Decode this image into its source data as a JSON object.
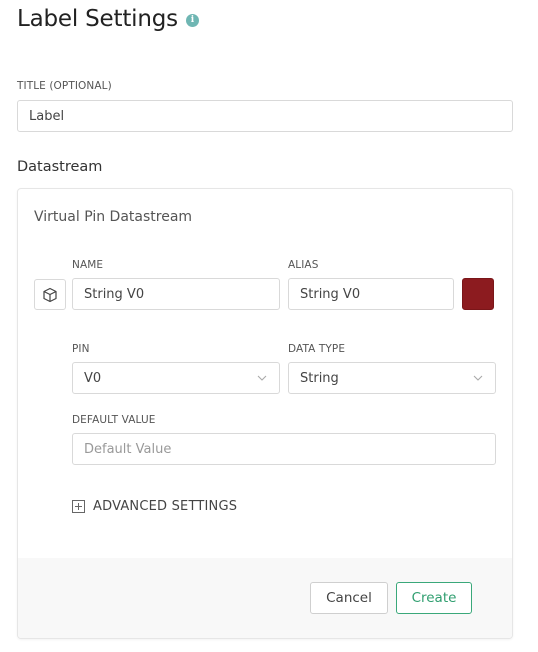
{
  "header": {
    "title": "Label Settings",
    "info_icon": "info-icon",
    "info_symbol": "i"
  },
  "title_field": {
    "label": "TITLE (OPTIONAL)",
    "value": "Label"
  },
  "datastream": {
    "heading": "Datastream",
    "card_title": "Virtual Pin Datastream",
    "cube_icon": "cube-icon",
    "name": {
      "label": "NAME",
      "value": "String V0"
    },
    "alias": {
      "label": "ALIAS",
      "value": "String V0"
    },
    "color": "#8c1b1f",
    "pin": {
      "label": "PIN",
      "value": "V0"
    },
    "data_type": {
      "label": "DATA TYPE",
      "value": "String"
    },
    "default_value": {
      "label": "DEFAULT VALUE",
      "placeholder": "Default Value"
    },
    "advanced_settings": "ADVANCED SETTINGS"
  },
  "actions": {
    "cancel": "Cancel",
    "create": "Create"
  }
}
